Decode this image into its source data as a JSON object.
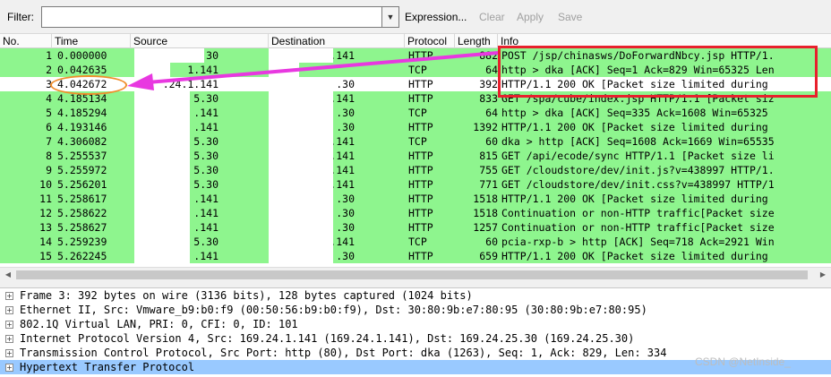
{
  "toolbar": {
    "filter_label": "Filter:",
    "filter_value": "",
    "expression": "Expression...",
    "clear": "Clear",
    "apply": "Apply",
    "save": "Save"
  },
  "columns": [
    "No.",
    "Time",
    "Source",
    "Destination",
    "Protocol",
    "Length",
    "Info"
  ],
  "packets": [
    {
      "no": "1",
      "time": "0.000000",
      "src": ".30",
      "dst": ".141",
      "proto": "HTTP",
      "len": "882",
      "info": "POST /jsp/chinasws/DoForwardNbcy.jsp HTTP/1."
    },
    {
      "no": "2",
      "time": "0.042635",
      "src": "1.141",
      "dst": "",
      "proto": "TCP",
      "len": "64",
      "info": "http > dka [ACK] Seq=1 Ack=829 Win=65325 Len"
    },
    {
      "no": "3",
      "time": "4.042672",
      "src": ".24.1.141",
      "dst": ".30",
      "proto": "HTTP",
      "len": "392",
      "info": "HTTP/1.1 200 OK [Packet size limited during"
    },
    {
      "no": "4",
      "time": "4.185134",
      "src": "5.30",
      "dst": ".141",
      "proto": "HTTP",
      "len": "833",
      "info": "GET /spa/cube/index.jsp HTTP/1.1 [Packet siz"
    },
    {
      "no": "5",
      "time": "4.185294",
      "src": ".141",
      "dst": ".30",
      "proto": "TCP",
      "len": "64",
      "info": "http > dka [ACK] Seq=335 Ack=1608 Win=65325"
    },
    {
      "no": "6",
      "time": "4.193146",
      "src": ".141",
      "dst": ".30",
      "proto": "HTTP",
      "len": "1392",
      "info": "HTTP/1.1 200 OK [Packet size limited during"
    },
    {
      "no": "7",
      "time": "4.306082",
      "src": "5.30",
      "dst": ".141",
      "proto": "TCP",
      "len": "60",
      "info": "dka > http [ACK] Seq=1608 Ack=1669 Win=65535"
    },
    {
      "no": "8",
      "time": "5.255537",
      "src": "5.30",
      "dst": ".141",
      "proto": "HTTP",
      "len": "815",
      "info": "GET /api/ecode/sync HTTP/1.1 [Packet size li"
    },
    {
      "no": "9",
      "time": "5.255972",
      "src": "5.30",
      "dst": ".141",
      "proto": "HTTP",
      "len": "755",
      "info": "GET /cloudstore/dev/init.js?v=438997 HTTP/1."
    },
    {
      "no": "10",
      "time": "5.256201",
      "src": "5.30",
      "dst": ".141",
      "proto": "HTTP",
      "len": "771",
      "info": "GET /cloudstore/dev/init.css?v=438997 HTTP/1"
    },
    {
      "no": "11",
      "time": "5.258617",
      "src": ".141",
      "dst": ".30",
      "proto": "HTTP",
      "len": "1518",
      "info": "HTTP/1.1 200 OK [Packet size limited during"
    },
    {
      "no": "12",
      "time": "5.258622",
      "src": ".141",
      "dst": ".30",
      "proto": "HTTP",
      "len": "1518",
      "info": "Continuation or non-HTTP traffic[Packet size"
    },
    {
      "no": "13",
      "time": "5.258627",
      "src": ".141",
      "dst": ".30",
      "proto": "HTTP",
      "len": "1257",
      "info": "Continuation or non-HTTP traffic[Packet size"
    },
    {
      "no": "14",
      "time": "5.259239",
      "src": "5.30",
      "dst": ".141",
      "proto": "TCP",
      "len": "60",
      "info": "pcia-rxp-b > http [ACK] Seq=718 Ack=2921 Win"
    },
    {
      "no": "15",
      "time": "5.262245",
      "src": ".141",
      "dst": ".30",
      "proto": "HTTP",
      "len": "659",
      "info": "HTTP/1.1 200 OK [Packet size limited during"
    }
  ],
  "details": [
    {
      "label": "Frame 3: 392 bytes on wire (3136 bits), 128 bytes captured (1024 bits)"
    },
    {
      "label": "Ethernet II, Src: Vmware_b9:b0:f9 (00:50:56:b9:b0:f9), Dst: 30:80:9b:e7:80:95 (30:80:9b:e7:80:95)"
    },
    {
      "label": "802.1Q Virtual LAN, PRI: 0, CFI: 0, ID: 101"
    },
    {
      "label": "Internet Protocol Version 4, Src: 169.24.1.141 (169.24.1.141), Dst: 169.24.25.30 (169.24.25.30)"
    },
    {
      "label": "Transmission Control Protocol, Src Port: http (80), Dst Port: dka (1263), Seq: 1, Ack: 829, Len: 334"
    },
    {
      "label": "Hypertext Transfer Protocol"
    }
  ],
  "watermark": "CSDN @NetInside_",
  "colors": {
    "http_row": "#8ef58e",
    "selected_detail": "#99c9ff",
    "annotation_rect": "#e8202d",
    "annotation_ellipse": "#f08d2a",
    "annotation_arrow": "#e838e0"
  },
  "icons": {
    "dropdown": "chevron-down-icon",
    "expander": "plus-box-icon",
    "scroll_left": "arrow-left-icon",
    "scroll_right": "arrow-right-icon"
  }
}
